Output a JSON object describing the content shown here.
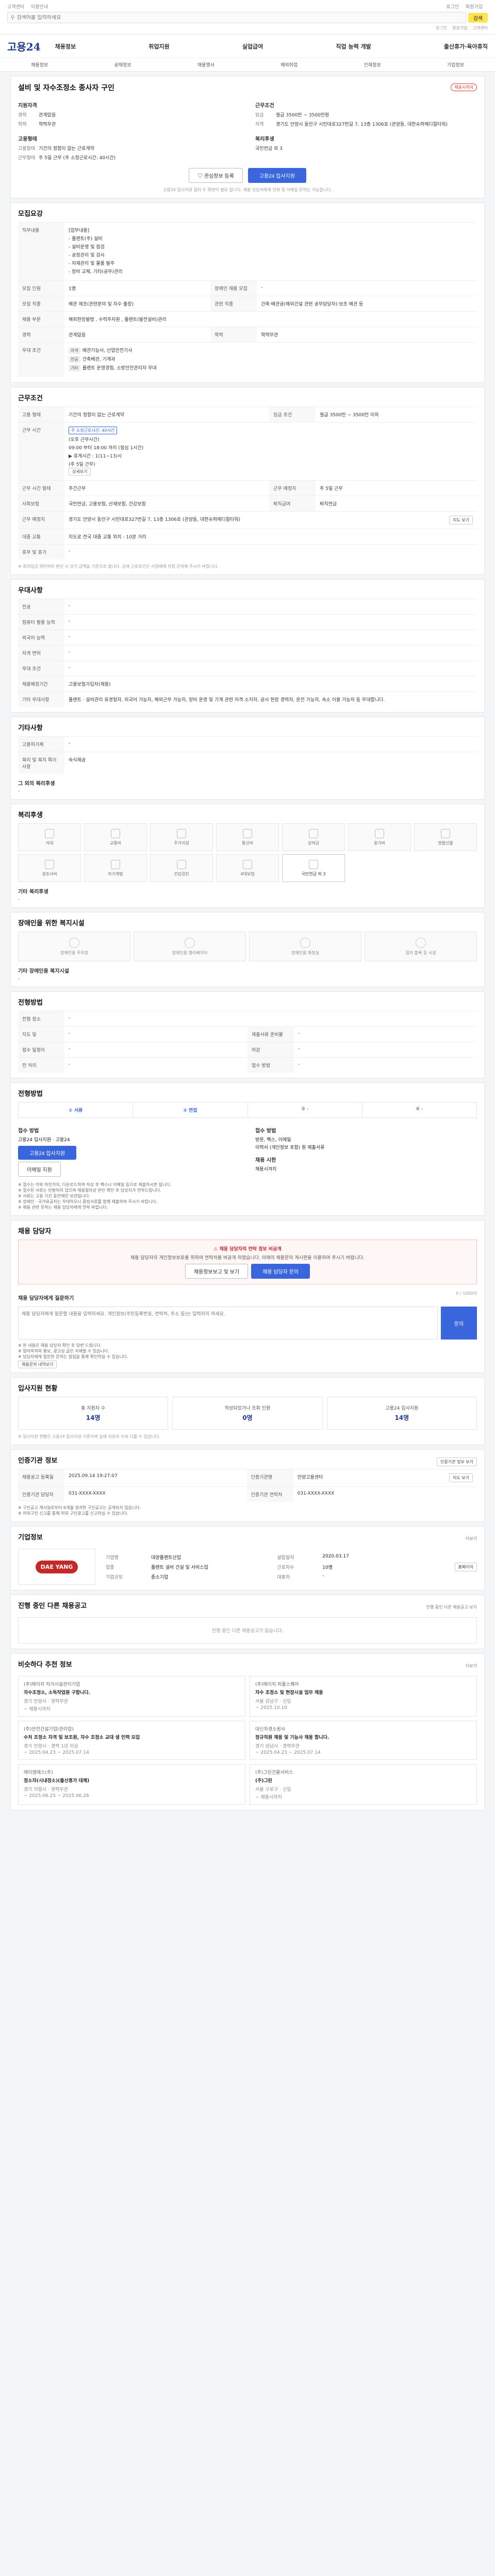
{
  "topbar": {
    "left_items": [
      "고객센터",
      "이용안내"
    ],
    "right_items": [
      "로그인",
      "회원가입"
    ],
    "search_placeholder": "검색어를 입력하세요",
    "search_button": "검색",
    "util_items": [
      "로그인",
      "회원가입",
      "고객센터"
    ]
  },
  "header": {
    "logo": "고용24",
    "gnb": [
      "채용정보",
      "취업지원",
      "실업급여",
      "직업 능력 개발",
      "출산휴가·육아휴직"
    ],
    "lnb": [
      "채용정보",
      "공채정보",
      "채용행사",
      "해외취업",
      "인재정보",
      "기업정보"
    ]
  },
  "summary": {
    "title": "설비 및 자수조정소 종사자 구인",
    "badge": "채용시까지",
    "left_heading": "지원자격",
    "left": [
      {
        "k": "경력",
        "v": "관계없음"
      },
      {
        "k": "학력",
        "v": "학력무관"
      }
    ],
    "right_heading": "근무조건",
    "right": [
      {
        "k": "임금",
        "v": "월급 3500만 ~ 3500만원"
      },
      {
        "k": "지역",
        "v": "경기도 안양시 동안구 시민대로327번길 7, 13층 1306호 (관양동, 대한슈퍼메디컬타워)"
      }
    ],
    "left2_heading": "고용형태",
    "left2": [
      {
        "k": "고용형태",
        "v": "기간의 정함이 없는 근로계약"
      },
      {
        "k": "근무형태",
        "v": "주 5일 근무 (주 소정근로시간: 40시간)"
      }
    ],
    "right2_heading": "복리후생",
    "right2": [
      {
        "k": "",
        "v": "국민연금 외 3"
      }
    ],
    "favorite_btn": "관심정보 등록",
    "apply_btn": "고용24 입사지원",
    "note": "고용24 입사지원 절차 두 화면이 필요 합니다. 채용 담당자에게 전화 및 이메일 문의는 가능합니다."
  },
  "recruit": {
    "heading": "모집요강",
    "duty_label": "직무내용",
    "duty_lines": [
      "[업무내용]",
      "- 플랜트(주) 설비",
      "- 설비운영 및 점검",
      "- 공정관리 및 검사",
      "- 자재관리 및 물품 발주",
      "- 장비 교체, 기타(공무)관리"
    ],
    "rows": [
      {
        "k": "모집 인원",
        "v": "1명",
        "k2": "장애인 채용 모집",
        "v2": "-"
      },
      {
        "k": "모집 직종",
        "v": "배관 제조(관련분야 및 자수 출장)",
        "k2": "관련 직종",
        "v2": "건축·배관공(해외건설 관련 공무담당자)·보조 배관 등"
      },
      {
        "k": "채용 부문",
        "v": "해외현장발령 , 수력주자원 , 플랜트(발전설비)관리",
        "k2": "",
        "v2": ""
      },
      {
        "k": "경력",
        "v": "관계없음",
        "k2": "학력",
        "v2": "학력무관"
      }
    ],
    "prefer_label": "우대 조건",
    "prefer": [
      {
        "tag": "자격",
        "text": "배관기능사, 산업안전기사"
      },
      {
        "tag": "전공",
        "text": "건축배관, 기계과"
      },
      {
        "tag": "기타",
        "text": "플랜트 운영경험, 소방안전관리자 우대"
      }
    ]
  },
  "conditions": {
    "heading": "근무조건",
    "rows": [
      {
        "k": "고용 형태",
        "v": "기간의 정함이 없는 근로계약",
        "k2": "임금 조건",
        "v2": "월급 3500만 ~ 3500만 이하"
      }
    ],
    "hours_label": "근무 시간",
    "hours_week": "주 소정근로시간: 40시간",
    "hours_lines": [
      "(오후 근무시간)",
      "09:00 부터 18:00 까지 (점심 1시간)",
      "▶ 휴게시간 : 1(11~13)시",
      "(주 5일 근무)"
    ],
    "hours_btn": "상세보기",
    "rows2": [
      {
        "k": "근무 시간 형태",
        "v": "주간근무",
        "k2": "근무 예정지",
        "v2": "주 5일 근무"
      },
      {
        "k": "사회보험",
        "v": "국민연금, 고용보험, 산재보험, 건강보험",
        "k2": "퇴직급여",
        "v2": "퇴직연금"
      }
    ],
    "location_label": "근무 예정지",
    "location": "경기도 안양시 동안구 시민대로327번길 7, 13층 1306호 (관양동, 대한슈퍼메디컬타워)",
    "location_btn": "지도 보기",
    "commute_label": "대중 교통",
    "commute": "지도로 전국 대중 교통 위치 - 10분 거리",
    "restroom_label": "휴무 및 휴가",
    "restroom": "-",
    "note": "※ 최저임금 위반여부 판단 시 상기 금액을 기준으로 합니다. 상세 근로조건은 사업체에 직접 문의해 주시기 바랍니다."
  },
  "apply": {
    "heading": "우대사항",
    "rows": [
      {
        "k": "전공",
        "v": "-"
      },
      {
        "k": "컴퓨터 활용 능력",
        "v": "-"
      },
      {
        "k": "외국어 능력",
        "v": "-"
      },
      {
        "k": "자격 면허",
        "v": "-"
      },
      {
        "k": "우대 조건",
        "v": "-"
      },
      {
        "k": "채용예정기간",
        "v": "고용보험가입자(채용)"
      },
      {
        "k": "기타 우대사항",
        "v": "플랜트 · 설비관리 유경험자, 외국어 가능자, 해외근무 가능자, 장비 운영 및 기계 관련 자격 소지자, 공사 현장 경력자, 운전 가능자, 숙소 이용 가능자 등 우대합니다."
      }
    ]
  },
  "etc": {
    "heading": "기타사항",
    "rows": [
      {
        "k": "고용허가제",
        "v": "-"
      },
      {
        "k": "복리 및 복지 특이 사항",
        "v": "숙식제공"
      }
    ],
    "other_label": "그 외의 복리후생",
    "other_value": "-"
  },
  "welfare": {
    "heading": "복리후생",
    "items": [
      {
        "label": "식대",
        "on": false
      },
      {
        "label": "교통비",
        "on": false
      },
      {
        "label": "주거지원",
        "on": false
      },
      {
        "label": "통신비",
        "on": false
      },
      {
        "label": "상여금",
        "on": false
      },
      {
        "label": "휴가비",
        "on": false
      },
      {
        "label": "명절선물",
        "on": false
      },
      {
        "label": "경조사비",
        "on": false
      },
      {
        "label": "자기계발",
        "on": false
      },
      {
        "label": "건강검진",
        "on": false
      },
      {
        "label": "4대보험",
        "on": false
      },
      {
        "label": "국민연금 외 3",
        "on": true
      }
    ],
    "other_label": "기타 복리후생",
    "other_value": "-"
  },
  "facility": {
    "heading": "장애인을 위한 복지시설",
    "items": [
      "장애인용 주차장",
      "장애인용 엘리베이터",
      "장애인용 화장실",
      "점자 블록 등 시설"
    ],
    "other_label": "기타 장애인용 복지시설",
    "other_value": "-"
  },
  "selection": {
    "heading": "전형방법",
    "rows": [
      {
        "k": "전형 장소",
        "v": "-",
        "k2": "",
        "v2": ""
      },
      {
        "k": "지도 및",
        "v": "-",
        "k2": "제출서류 준비물",
        "v2": "-"
      },
      {
        "k": "접수 일정이",
        "v": "-",
        "k2": "마감",
        "v2": "-"
      },
      {
        "k": "전 처리",
        "v": "-",
        "k2": "접수 방법",
        "v2": "-"
      }
    ]
  },
  "process": {
    "heading": "전형방법",
    "steps": [
      {
        "label": "① 서류",
        "on": true
      },
      {
        "label": "② 면접",
        "on": true
      },
      {
        "label": "③ -",
        "on": false
      },
      {
        "label": "④ -",
        "on": false
      }
    ],
    "apply_method_label": "접수 방법",
    "apply_method_value": "고용24 입사지원 · 고용24",
    "apply_btn": "고용24 입사지원",
    "email_btn": "이메일 지원",
    "docs_label": "접수 방법",
    "docs_lines": [
      "방문, 팩스, 이메일",
      "이력서 (개인정보 포함) 원 제출서류"
    ],
    "schedule_label": "채용 시한",
    "schedule_value": "채용시까지",
    "notes": [
      "※ 접수는 이와 마찬가지, 다운로드하여 작성 후 팩스나 이메일 등으로 제출하시면 됩니다.",
      "※ 접수된 서류는 반환되지 않으며 채용절차상 본인 확인 후 담당자가 연락드립니다.",
      "※ 서류는 고용 기간 동안에만 보관됩니다.",
      "※ 장애인 · 국가유공자는 우대하오니 증빙서류를 함께 제출하여 주시기 바랍니다.",
      "※ 채용 관련 문의는 채용 담당자에게 연락 바랍니다."
    ]
  },
  "manager": {
    "heading": "채용 담당자",
    "warn_title": "채용 담당자의 연락 정보 비공개",
    "warn_text": "채용 담당자의 개인정보보호를 위하여 연락처를 비공개 하였습니다. 아래의 채용문의 게시판을 이용하여 주시기 바랍니다.",
    "btn1": "채용정보보고 및 보기",
    "btn2": "채용 담당자 문의",
    "inquiry_heading": "채용 담당자에게 질문하기",
    "inquiry_count": "0 / 1000자",
    "inquiry_placeholder": "채용 담당자에게 질문할 내용을 입력하세요. 개인정보(주민등록번호, 연락처, 주소 등)는 입력하지 마세요.",
    "inquiry_submit": "문의",
    "inquiry_notes": [
      "※ 본 내용은 채용 담당자 확인 후 답변 드립니다.",
      "※ 영리목적의 홍보, 광고성 글은 삭제될 수 있습니다.",
      "※ 담당자에게 질문한 문의는 알림을 통해 확인하실 수 있습니다."
    ],
    "inquiry_btn": "채용문의 내역보기"
  },
  "stats": {
    "heading": "입사지원 현황",
    "items": [
      {
        "label": "총 지원자 수",
        "num": "14명"
      },
      {
        "label": "작성되었거나 조회 인원",
        "num": "0명"
      },
      {
        "label": "고용24 입사지원",
        "num": "14명"
      }
    ],
    "note": "※ 입사지원 현황은 고용24 입사지원 기준이며 실제 지원자 수와 다를 수 있습니다."
  },
  "register": {
    "heading": "인증기관 정보",
    "btn": "인증기관 정보 보기",
    "rows": [
      {
        "k": "채용공고 등록일",
        "v": "2025.09.14 19:27:07",
        "k2": "인증기관명",
        "v2": "안양고용센터",
        "btn": "지도 보기"
      },
      {
        "k": "인증기관 담당자",
        "v": "031-XXXX-XXXX",
        "k2": "인증기관 연락처",
        "v2": "031-XXXX-XXXX"
      }
    ],
    "notes": [
      "※ 구인공고 게시일로부터 6개월 경과한 구인공고는 공개되지 않습니다.",
      "※ 허위구인 신고를 통해 허위 구인광고를 신고하실 수 있습니다."
    ]
  },
  "company": {
    "heading": "기업정보",
    "more": "더보기",
    "logo_text": "DAE YANG",
    "info": [
      {
        "k": "기업명",
        "v": "대양플랜트산업"
      },
      {
        "k": "설립일자",
        "v": "2020.03.17"
      },
      {
        "k": "업종",
        "v": "플랜트 설비 건설 및 서비스업"
      },
      {
        "k": "근로자수",
        "v": "10명"
      },
      {
        "k": "기업규모",
        "v": "중소기업"
      },
      {
        "k": "대표자",
        "v": "-"
      }
    ],
    "homepage_btn": "홈페이지"
  },
  "others": {
    "heading": "진행 중인 다른 채용공고",
    "more": "진행 중인 다른 채용공고 보기",
    "empty": "진행 중인 다른 채용공고가 없습니다."
  },
  "recommend": {
    "heading": "비슷하다 추천 정보",
    "more": "더보기",
    "items": [
      {
        "co": "(주)에이치 자가시설관리기업",
        "ti": "자수조정소, 소독작업원 구합니다.",
        "meta": "경기 안양시 · 경력무관",
        "dl": "~ 채용시까지"
      },
      {
        "co": "(주)에이치 피플스퀘어",
        "ti": "자수 조정소 및 현장시설 업무 채용",
        "meta": "서울 강남구 · 신입",
        "dl": "~ 2025.10.10"
      },
      {
        "co": "(주)안전건설기업(관리업)",
        "ti": "수처 조정소 자격 및 보조원, 자수 조정소 교대 생 인력 모집",
        "meta": "경기 안양시 · 경력 1년 이상",
        "dl": "~ 2025.04.23 ~ 2025.07.14"
      },
      {
        "co": "대신자경소원사",
        "ti": "정규직원 채용 및 기능사 채용 합니다.",
        "meta": "경기 성남시 · 경력무관",
        "dl": "~ 2025.04.23 ~ 2025.07.14"
      },
      {
        "co": "에이엠에스(주)",
        "ti": "정소자(시내정소)(출산휴가 대체)",
        "meta": "경기 의왕시 · 경력무관",
        "dl": "~ 2025.06.25 ~ 2025.06.26"
      },
      {
        "co": "(주)그린건물서비스",
        "ti": "(주)그린",
        "meta": "서울 구로구 · 신입",
        "dl": "~ 채용시까지"
      }
    ]
  }
}
